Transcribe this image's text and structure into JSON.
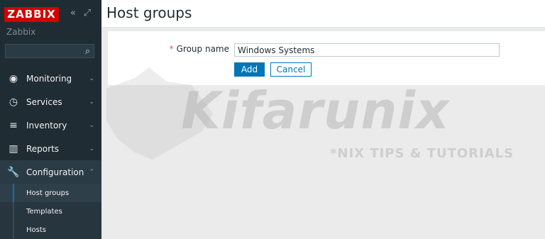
{
  "sidebar": {
    "logo": "ZABBIX",
    "subtitle": "Zabbix",
    "collapse_icon": "double-chevron-left-icon",
    "kiosk_icon": "expand-icon",
    "search": {
      "value": "",
      "placeholder": "",
      "icon": "search-icon"
    },
    "menu": [
      {
        "label": "Monitoring",
        "icon": "eye-icon",
        "caret": "chevron-down-icon"
      },
      {
        "label": "Services",
        "icon": "clock-icon",
        "caret": "chevron-down-icon"
      },
      {
        "label": "Inventory",
        "icon": "list-icon",
        "caret": "chevron-down-icon"
      },
      {
        "label": "Reports",
        "icon": "bar-chart-icon",
        "caret": "chevron-down-icon"
      },
      {
        "label": "Configuration",
        "icon": "wrench-icon",
        "caret": "chevron-up-icon"
      }
    ],
    "submenu": [
      {
        "label": "Host groups",
        "active": true
      },
      {
        "label": "Templates",
        "active": false
      },
      {
        "label": "Hosts",
        "active": false
      }
    ]
  },
  "header": {
    "title": "Host groups"
  },
  "form": {
    "group_name_label": "Group name",
    "required_mark": "*",
    "group_name_value": "Windows Systems",
    "add_label": "Add",
    "cancel_label": "Cancel"
  },
  "watermark": {
    "text": "Kifarunix",
    "tagline": "*NIX TIPS & TUTORIALS"
  },
  "colors": {
    "sidebar_bg": "#1f2c33",
    "brand_red": "#d40000",
    "accent_blue": "#0275b8"
  }
}
